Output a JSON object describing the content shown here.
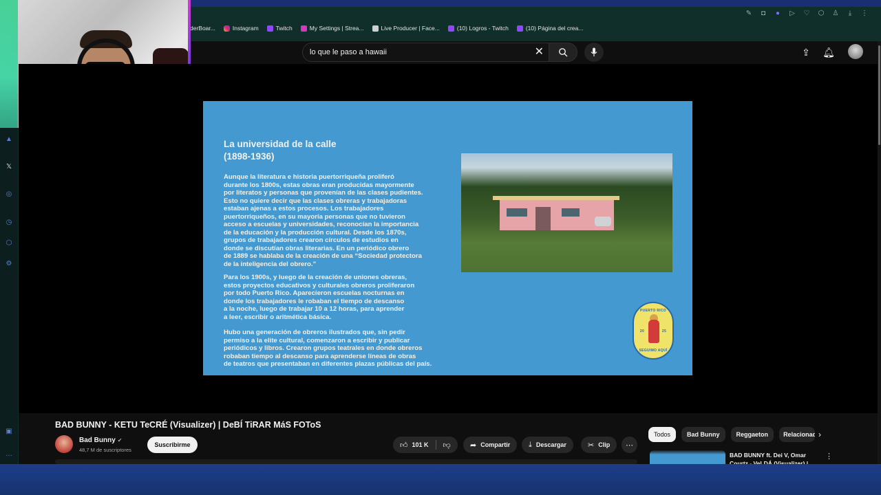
{
  "browser": {
    "bookmarks": [
      {
        "label": "derBoar...",
        "icon": "bookmark-icon"
      },
      {
        "label": "Instagram",
        "icon": "instagram-icon"
      },
      {
        "label": "Twitch",
        "icon": "twitch-icon"
      },
      {
        "label": "My Settings | Strea...",
        "icon": "streamlabs-icon"
      },
      {
        "label": "Live Producer | Face...",
        "icon": "facebook-icon"
      },
      {
        "label": "(10) Logros - Twitch",
        "icon": "twitch-icon"
      },
      {
        "label": "(10) Página del crea...",
        "icon": "twitch-icon"
      }
    ]
  },
  "search": {
    "query": "lo que le paso a hawaii"
  },
  "slide": {
    "title_line1": "La universidad de la calle",
    "title_line2": "(1898-1936)",
    "paragraph1": "Aunque la literatura e historia puertorriqueña proliferó\ndurante los 1800s, estas obras eran producidas mayormente\npor literatos y personas que provenían de las clases pudientes.\nEsto no quiere decir que las clases obreras y trabajadoras\nestaban ajenas a estos procesos. Los trabajadores\npuertorriqueños, en su mayoría personas que no tuvieron\nacceso a escuelas y universidades, reconocían la importancia\nde la educación y la producción cultural. Desde los 1870s,\ngrupos de trabajadores crearon círculos de estudios en\ndonde se discutían obras literarias. En un periódico obrero\nde 1889 se hablaba de la creación de una “Sociedad protectora\nde la inteligencia del obrero.”",
    "paragraph2": "Para los 1900s, y luego de la creación de uniones obreras,\nestos proyectos educativos y culturales obreros proliferaron\npor todo Puerto Rico. Aparecieron escuelas nocturnas en\ndonde los trabajadores le robaban el tiempo de descanso\na la noche, luego de trabajar 10 a 12 horas, para aprender\na leer, escribir o aritmética básica.",
    "paragraph3": "Hubo una generación de obreros ilustrados que, sin pedir\npermiso a la elite cultural, comenzaron a escribir y publicar\nperiódicos y libros. Crearon grupos teatrales en donde obreros\nrobaban tiempo al descanso para aprenderse líneas de obras\nde teatros que presentaban en diferentes plazas públicas del país.",
    "seal_top": "PUERTO RICO",
    "seal_left": "20",
    "seal_right": "25",
    "seal_bottom": "SEGUIMO AQUÍ"
  },
  "video": {
    "title": "BAD BUNNY - KETU TeCRÉ (Visualizer) | DeBÍ TiRAR MáS FOToS",
    "channel": "Bad Bunny",
    "subscribers": "48,7 M de suscriptores",
    "subscribe_label": "Suscribirme",
    "likes": "101 K",
    "share_label": "Compartir",
    "download_label": "Descargar",
    "clip_label": "Clip"
  },
  "chips": [
    "Todos",
    "Bad Bunny",
    "Reggaeton",
    "Relacionad"
  ],
  "recommendation": {
    "title": "BAD BUNNY ft. Dei V, Omar Courtz - VeLDÁ (Visualizer) |"
  },
  "colors": {
    "slide_blue": "#4499d1",
    "chrome_teal": "#102e2a",
    "taskbar_blue": "#1c3d88"
  }
}
